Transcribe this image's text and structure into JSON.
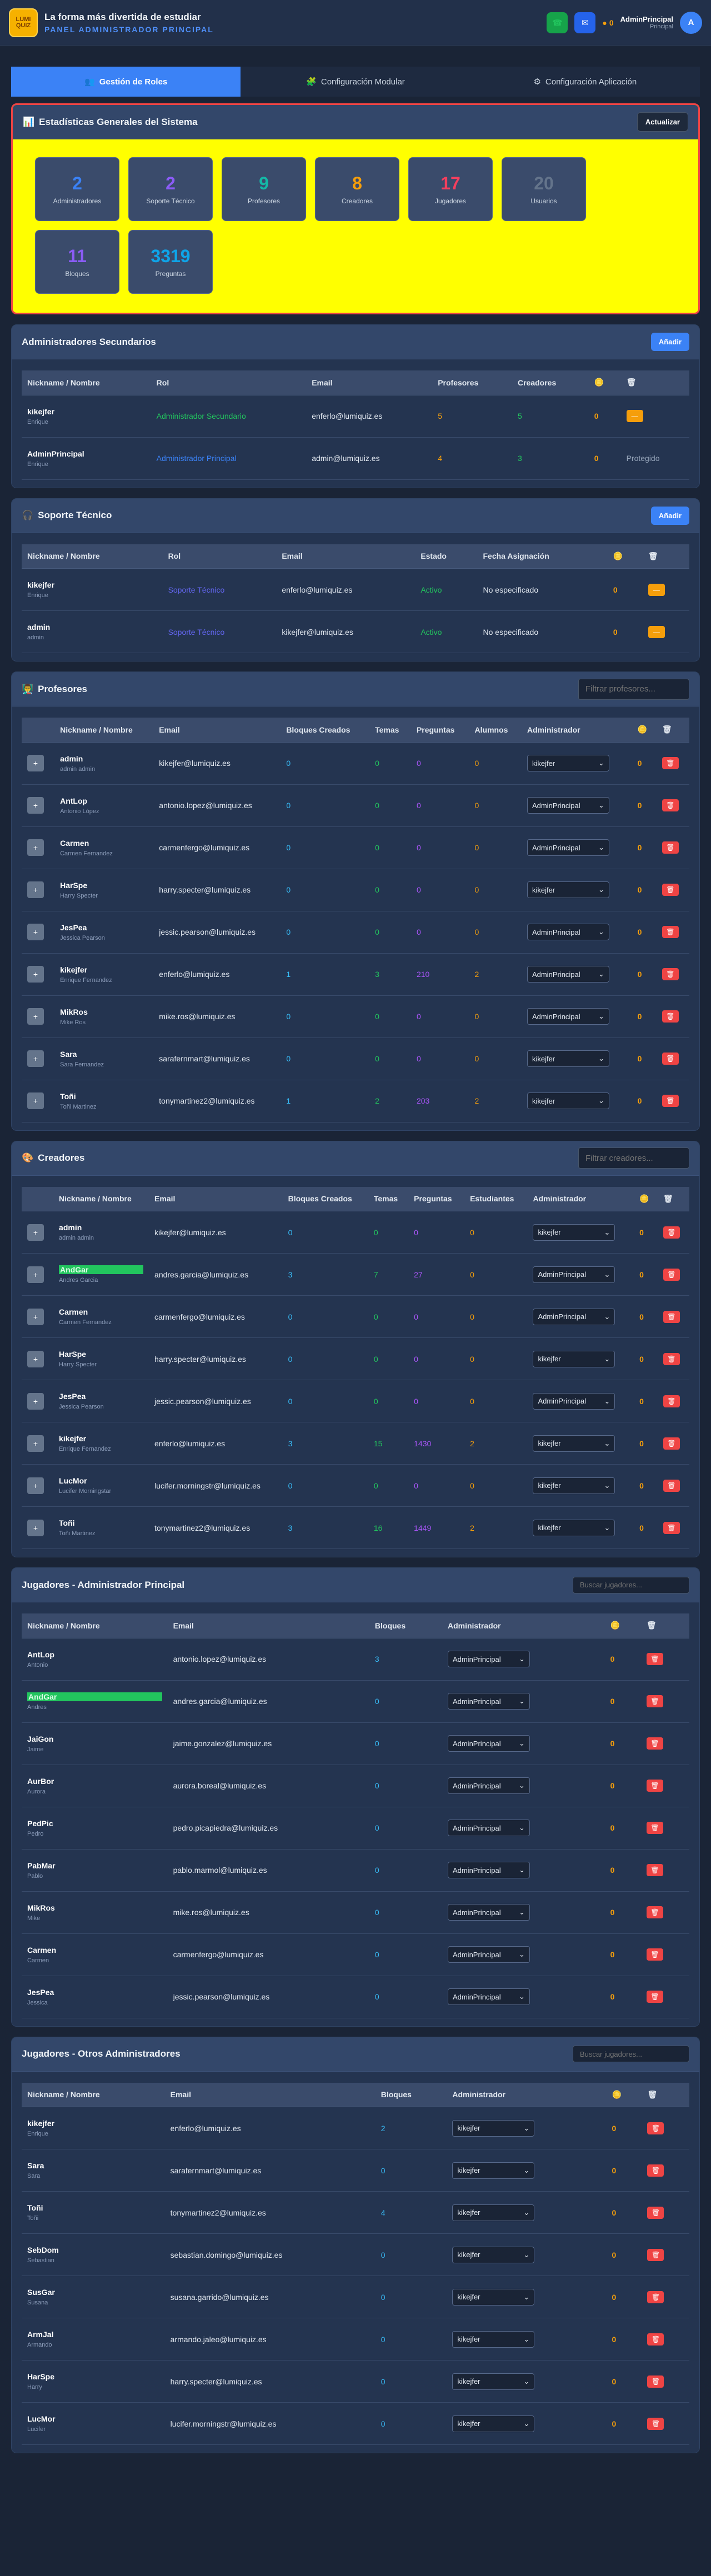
{
  "header": {
    "logo_line1": "LUMI",
    "logo_line2": "QUIZ",
    "tagline": "La forma más divertida de estudiar",
    "panel": "PANEL ADMINISTRADOR PRINCIPAL",
    "coins": "0",
    "user_name": "AdminPrincipal",
    "user_role": "Principal",
    "avatar_letter": "A"
  },
  "tabs": [
    {
      "label": "Gestión de Roles"
    },
    {
      "label": "Configuración Modular"
    },
    {
      "label": "Configuración Aplicación"
    }
  ],
  "stats": {
    "title": "Estadísticas Generales del Sistema",
    "refresh": "Actualizar",
    "items": [
      {
        "n": "2",
        "l": "Administradores"
      },
      {
        "n": "2",
        "l": "Soporte Técnico"
      },
      {
        "n": "9",
        "l": "Profesores"
      },
      {
        "n": "8",
        "l": "Creadores"
      },
      {
        "n": "17",
        "l": "Jugadores"
      },
      {
        "n": "20",
        "l": "Usuarios"
      },
      {
        "n": "11",
        "l": "Bloques"
      },
      {
        "n": "3319",
        "l": "Preguntas"
      }
    ],
    "colors": [
      "#3b82f6",
      "#8b5cf6",
      "#14b8a6",
      "#f59e0b",
      "#f43f5e",
      "#64748b",
      "#8b5cf6",
      "#0ea5e9"
    ]
  },
  "admins": {
    "title": "Administradores Secundarios",
    "add": "Añadir",
    "headers": [
      "Nickname / Nombre",
      "Rol",
      "Email",
      "Profesores",
      "Creadores",
      "🪙",
      "🗑"
    ],
    "rows": [
      {
        "nick": "kikejfer",
        "name": "Enrique",
        "role": "Administrador Secundario",
        "email": "enferlo@lumiquiz.es",
        "prof": "5",
        "cre": "5",
        "coins": "0",
        "action": ""
      },
      {
        "nick": "AdminPrincipal",
        "name": "Enrique",
        "role": "Administrador Principal",
        "email": "admin@lumiquiz.es",
        "prof": "4",
        "cre": "3",
        "coins": "0",
        "action": "Protegido"
      }
    ]
  },
  "support": {
    "title": "Soporte Técnico",
    "add": "Añadir",
    "headers": [
      "Nickname / Nombre",
      "Rol",
      "Email",
      "Estado",
      "Fecha Asignación",
      "🪙",
      "🗑"
    ],
    "rows": [
      {
        "nick": "kikejfer",
        "name": "Enrique",
        "role": "Soporte Técnico",
        "email": "enferlo@lumiquiz.es",
        "status": "Activo",
        "date": "No especificado",
        "coins": "0"
      },
      {
        "nick": "admin",
        "name": "admin",
        "role": "Soporte Técnico",
        "email": "kikejfer@lumiquiz.es",
        "status": "Activo",
        "date": "No especificado",
        "coins": "0"
      }
    ]
  },
  "teachers": {
    "title": "Profesores",
    "filter": "Filtrar profesores...",
    "headers": [
      "",
      "Nickname / Nombre",
      "Email",
      "Bloques Creados",
      "Temas",
      "Preguntas",
      "Alumnos",
      "Administrador",
      "🪙",
      "🗑"
    ],
    "rows": [
      {
        "nick": "admin",
        "name": "admin admin",
        "email": "kikejfer@lumiquiz.es",
        "b": "0",
        "t": "0",
        "p": "0",
        "a": "0",
        "adm": "kikejfer",
        "c": "0"
      },
      {
        "nick": "AntLop",
        "name": "Antonio López",
        "email": "antonio.lopez@lumiquiz.es",
        "b": "0",
        "t": "0",
        "p": "0",
        "a": "0",
        "adm": "AdminPrincipal",
        "c": "0"
      },
      {
        "nick": "Carmen",
        "name": "Carmen Fernandez",
        "email": "carmenfergo@lumiquiz.es",
        "b": "0",
        "t": "0",
        "p": "0",
        "a": "0",
        "adm": "AdminPrincipal",
        "c": "0"
      },
      {
        "nick": "HarSpe",
        "name": "Harry Specter",
        "email": "harry.specter@lumiquiz.es",
        "b": "0",
        "t": "0",
        "p": "0",
        "a": "0",
        "adm": "kikejfer",
        "c": "0"
      },
      {
        "nick": "JesPea",
        "name": "Jessica Pearson",
        "email": "jessic.pearson@lumiquiz.es",
        "b": "0",
        "t": "0",
        "p": "0",
        "a": "0",
        "adm": "AdminPrincipal",
        "c": "0"
      },
      {
        "nick": "kikejfer",
        "name": "Enrique Fernandez",
        "email": "enferlo@lumiquiz.es",
        "b": "1",
        "t": "3",
        "p": "210",
        "a": "2",
        "adm": "AdminPrincipal",
        "c": "0"
      },
      {
        "nick": "MikRos",
        "name": "Mike Ros",
        "email": "mike.ros@lumiquiz.es",
        "b": "0",
        "t": "0",
        "p": "0",
        "a": "0",
        "adm": "AdminPrincipal",
        "c": "0"
      },
      {
        "nick": "Sara",
        "name": "Sara Fernandez",
        "email": "sarafernmart@lumiquiz.es",
        "b": "0",
        "t": "0",
        "p": "0",
        "a": "0",
        "adm": "kikejfer",
        "c": "0"
      },
      {
        "nick": "Toñi",
        "name": "Toñi Martinez",
        "email": "tonymartinez2@lumiquiz.es",
        "b": "1",
        "t": "2",
        "p": "203",
        "a": "2",
        "adm": "kikejfer",
        "c": "0"
      }
    ]
  },
  "creators": {
    "title": "Creadores",
    "filter": "Filtrar creadores...",
    "headers": [
      "",
      "Nickname / Nombre",
      "Email",
      "Bloques Creados",
      "Temas",
      "Preguntas",
      "Estudiantes",
      "Administrador",
      "🪙",
      "🗑"
    ],
    "rows": [
      {
        "nick": "admin",
        "name": "admin admin",
        "email": "kikejfer@lumiquiz.es",
        "b": "0",
        "t": "0",
        "p": "0",
        "a": "0",
        "adm": "kikejfer",
        "c": "0",
        "hl": false
      },
      {
        "nick": "AndGar",
        "name": "Andres Garcia",
        "email": "andres.garcia@lumiquiz.es",
        "b": "3",
        "t": "7",
        "p": "27",
        "a": "0",
        "adm": "AdminPrincipal",
        "c": "0",
        "hl": true
      },
      {
        "nick": "Carmen",
        "name": "Carmen Fernandez",
        "email": "carmenfergo@lumiquiz.es",
        "b": "0",
        "t": "0",
        "p": "0",
        "a": "0",
        "adm": "AdminPrincipal",
        "c": "0",
        "hl": false
      },
      {
        "nick": "HarSpe",
        "name": "Harry Specter",
        "email": "harry.specter@lumiquiz.es",
        "b": "0",
        "t": "0",
        "p": "0",
        "a": "0",
        "adm": "kikejfer",
        "c": "0",
        "hl": false
      },
      {
        "nick": "JesPea",
        "name": "Jessica Pearson",
        "email": "jessic.pearson@lumiquiz.es",
        "b": "0",
        "t": "0",
        "p": "0",
        "a": "0",
        "adm": "AdminPrincipal",
        "c": "0",
        "hl": false
      },
      {
        "nick": "kikejfer",
        "name": "Enrique Fernandez",
        "email": "enferlo@lumiquiz.es",
        "b": "3",
        "t": "15",
        "p": "1430",
        "a": "2",
        "adm": "kikejfer",
        "c": "0",
        "hl": false
      },
      {
        "nick": "LucMor",
        "name": "Lucifer Morningstar",
        "email": "lucifer.morningstr@lumiquiz.es",
        "b": "0",
        "t": "0",
        "p": "0",
        "a": "0",
        "adm": "kikejfer",
        "c": "0",
        "hl": false
      },
      {
        "nick": "Toñi",
        "name": "Toñi Martinez",
        "email": "tonymartinez2@lumiquiz.es",
        "b": "3",
        "t": "16",
        "p": "1449",
        "a": "2",
        "adm": "kikejfer",
        "c": "0",
        "hl": false
      }
    ]
  },
  "players_main": {
    "title": "Jugadores - Administrador Principal",
    "filter": "Buscar jugadores...",
    "headers": [
      "Nickname / Nombre",
      "Email",
      "Bloques",
      "Administrador",
      "🪙",
      "🗑"
    ],
    "rows": [
      {
        "nick": "AntLop",
        "name": "Antonio",
        "email": "antonio.lopez@lumiquiz.es",
        "b": "3",
        "adm": "AdminPrincipal",
        "c": "0",
        "hl": false
      },
      {
        "nick": "AndGar",
        "name": "Andres",
        "email": "andres.garcia@lumiquiz.es",
        "b": "0",
        "adm": "AdminPrincipal",
        "c": "0",
        "hl": true
      },
      {
        "nick": "JaiGon",
        "name": "Jaime",
        "email": "jaime.gonzalez@lumiquiz.es",
        "b": "0",
        "adm": "AdminPrincipal",
        "c": "0",
        "hl": false
      },
      {
        "nick": "AurBor",
        "name": "Aurora",
        "email": "aurora.boreal@lumiquiz.es",
        "b": "0",
        "adm": "AdminPrincipal",
        "c": "0",
        "hl": false
      },
      {
        "nick": "PedPic",
        "name": "Pedro",
        "email": "pedro.picapiedra@lumiquiz.es",
        "b": "0",
        "adm": "AdminPrincipal",
        "c": "0",
        "hl": false
      },
      {
        "nick": "PabMar",
        "name": "Pablo",
        "email": "pablo.marmol@lumiquiz.es",
        "b": "0",
        "adm": "AdminPrincipal",
        "c": "0",
        "hl": false
      },
      {
        "nick": "MikRos",
        "name": "Mike",
        "email": "mike.ros@lumiquiz.es",
        "b": "0",
        "adm": "AdminPrincipal",
        "c": "0",
        "hl": false
      },
      {
        "nick": "Carmen",
        "name": "Carmen",
        "email": "carmenfergo@lumiquiz.es",
        "b": "0",
        "adm": "AdminPrincipal",
        "c": "0",
        "hl": false
      },
      {
        "nick": "JesPea",
        "name": "Jessica",
        "email": "jessic.pearson@lumiquiz.es",
        "b": "0",
        "adm": "AdminPrincipal",
        "c": "0",
        "hl": false
      }
    ]
  },
  "players_other": {
    "title": "Jugadores - Otros Administradores",
    "filter": "Buscar jugadores...",
    "headers": [
      "Nickname / Nombre",
      "Email",
      "Bloques",
      "Administrador",
      "🪙",
      "🗑"
    ],
    "rows": [
      {
        "nick": "kikejfer",
        "name": "Enrique",
        "email": "enferlo@lumiquiz.es",
        "b": "2",
        "adm": "kikejfer",
        "c": "0"
      },
      {
        "nick": "Sara",
        "name": "Sara",
        "email": "sarafernmart@lumiquiz.es",
        "b": "0",
        "adm": "kikejfer",
        "c": "0"
      },
      {
        "nick": "Toñi",
        "name": "Toñi",
        "email": "tonymartinez2@lumiquiz.es",
        "b": "4",
        "adm": "kikejfer",
        "c": "0"
      },
      {
        "nick": "SebDom",
        "name": "Sebastian",
        "email": "sebastian.domingo@lumiquiz.es",
        "b": "0",
        "adm": "kikejfer",
        "c": "0"
      },
      {
        "nick": "SusGar",
        "name": "Susana",
        "email": "susana.garrido@lumiquiz.es",
        "b": "0",
        "adm": "kikejfer",
        "c": "0"
      },
      {
        "nick": "ArmJal",
        "name": "Armando",
        "email": "armando.jaleo@lumiquiz.es",
        "b": "0",
        "adm": "kikejfer",
        "c": "0"
      },
      {
        "nick": "HarSpe",
        "name": "Harry",
        "email": "harry.specter@lumiquiz.es",
        "b": "0",
        "adm": "kikejfer",
        "c": "0"
      },
      {
        "nick": "LucMor",
        "name": "Lucifer",
        "email": "lucifer.morningstr@lumiquiz.es",
        "b": "0",
        "adm": "kikejfer",
        "c": "0"
      }
    ]
  }
}
